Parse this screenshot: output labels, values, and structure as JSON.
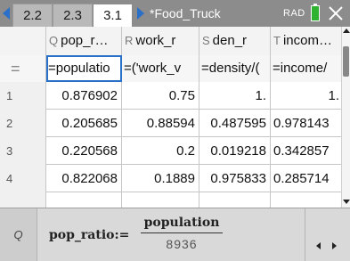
{
  "tabs": [
    {
      "label": "2.2",
      "active": false
    },
    {
      "label": "2.3",
      "active": false
    },
    {
      "label": "3.1",
      "active": true
    }
  ],
  "document_title": "*Food_Truck",
  "angle_mode": "RAD",
  "columns": [
    {
      "letter": "Q",
      "name": "pop_r…",
      "formula": "=populatio"
    },
    {
      "letter": "R",
      "name": "work_r",
      "formula": "=('work_v"
    },
    {
      "letter": "S",
      "name": "den_r",
      "formula": "=density/("
    },
    {
      "letter": "T",
      "name": "incom…",
      "formula": "=income/"
    }
  ],
  "formula_row_marker": "=",
  "rows": [
    {
      "index": "1",
      "cells": [
        "0.876902",
        "0.75",
        "1.",
        "1."
      ]
    },
    {
      "index": "2",
      "cells": [
        "0.205685",
        "0.88594",
        "0.487595",
        "0.978143"
      ]
    },
    {
      "index": "3",
      "cells": [
        "0.220568",
        "0.2",
        "0.019218",
        "0.342857"
      ]
    },
    {
      "index": "4",
      "cells": [
        "0.822068",
        "0.1889",
        "0.975833",
        "0.285714"
      ]
    },
    {
      "index": "",
      "cells": [
        "",
        "",
        "",
        ""
      ]
    }
  ],
  "entry_line": {
    "column_ref": "Q",
    "variable": "pop_ratio:=",
    "numerator": "population",
    "denominator": "8936"
  },
  "colors": {
    "topbar": "#8c8c8c",
    "selection": "#2970c8",
    "battery": "#2fb22f"
  },
  "icons": [
    "chevron-left-icon",
    "chevron-right-icon",
    "battery-icon",
    "close-icon",
    "scroll-up-icon",
    "scroll-down-icon",
    "arrow-left-icon",
    "arrow-right-icon"
  ]
}
